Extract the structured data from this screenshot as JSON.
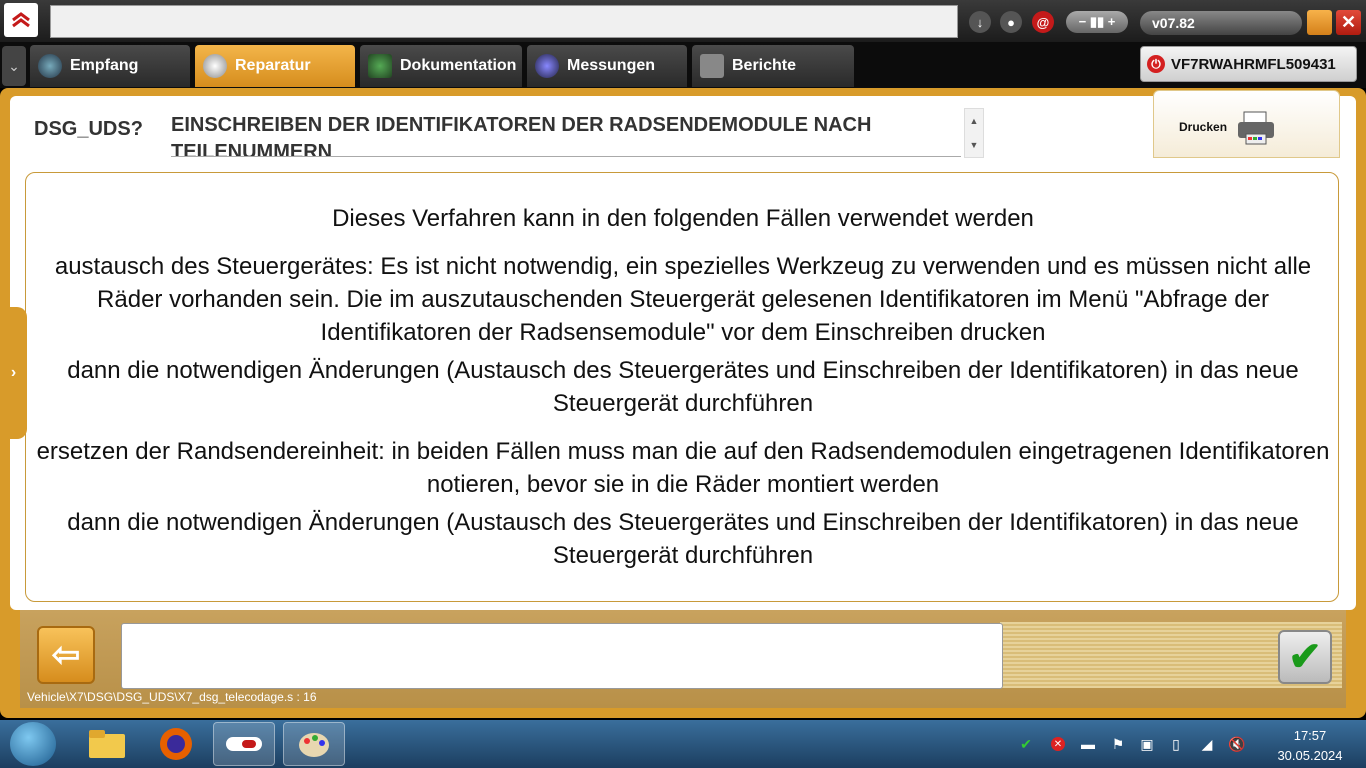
{
  "app": {
    "version": "v07.82"
  },
  "tabs": [
    {
      "label": "Empfang"
    },
    {
      "label": "Reparatur"
    },
    {
      "label": "Dokumentation"
    },
    {
      "label": "Messungen"
    },
    {
      "label": "Berichte"
    }
  ],
  "vehicle": {
    "vin": "VF7RWAHRMFL509431"
  },
  "procedure": {
    "code": "DSG_UDS?",
    "title": "EINSCHREIBEN DER IDENTIFIKATOREN DER RADSENDEMODULE NACH TEILENUMMERN"
  },
  "print": {
    "label": "Drucken"
  },
  "content": {
    "paragraphs": [
      "Dieses Verfahren kann in den folgenden Fällen verwendet werden",
      "austausch des Steuergerätes: Es ist nicht notwendig, ein spezielles Werkzeug zu verwenden und es müssen nicht alle Räder vorhanden sein. Die im auszutauschenden Steuergerät gelesenen Identifikatoren im Menü \"Abfrage der Identifikatoren der Radsensemodule\" vor dem Einschreiben drucken",
      "dann die notwendigen Änderungen (Austausch des Steuergerätes und Einschreiben der Identifikatoren) in das neue Steuergerät durchführen",
      "ersetzen der Randsendereinheit: in beiden Fällen muss man die auf den Radsendemodulen eingetragenen Identifikatoren notieren, bevor sie in die Räder montiert werden",
      "dann die notwendigen Änderungen (Austausch des Steuergerätes und Einschreiben der Identifikatoren) in das neue Steuergerät durchführen"
    ]
  },
  "footer": {
    "path": "Vehicle\\X7\\DSG\\DSG_UDS\\X7_dsg_telecodage.s : 16"
  },
  "taskbar": {
    "time": "17:57",
    "date": "30.05.2024"
  },
  "colors": {
    "accent": "#d89b2a",
    "close": "#d42020",
    "ok": "#1a9a1a"
  }
}
